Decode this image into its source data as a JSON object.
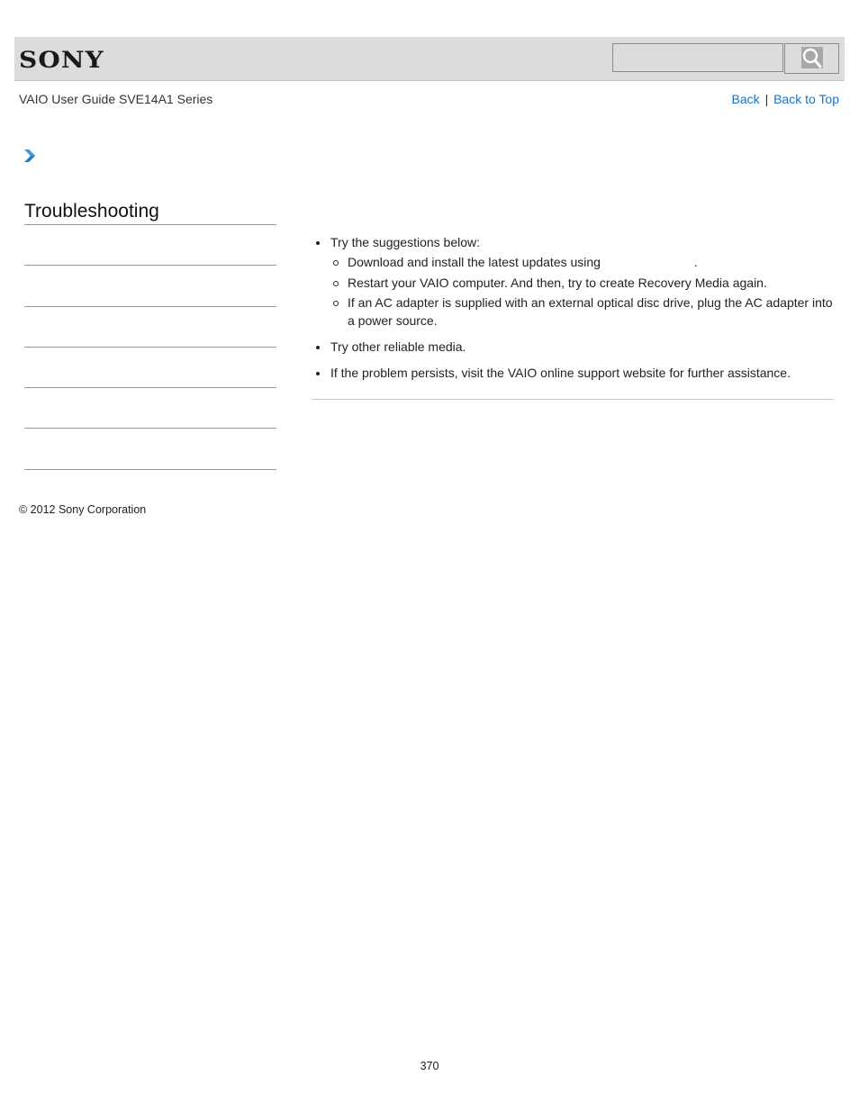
{
  "header": {
    "logo_text": "SONY",
    "search": {
      "placeholder": "",
      "value": "",
      "button_icon": "search-icon"
    }
  },
  "subheader": {
    "guide_title": "VAIO User Guide SVE14A1 Series",
    "links": {
      "back": "Back",
      "separator": "|",
      "back_to_top": "Back to Top"
    }
  },
  "breadcrumb": {
    "icon": "chevron-right-icon",
    "accent_color": "#1e7fc4"
  },
  "sidebar": {
    "heading": "Troubleshooting",
    "items": [
      {
        "label": ""
      },
      {
        "label": ""
      },
      {
        "label": ""
      },
      {
        "label": ""
      },
      {
        "label": ""
      },
      {
        "label": ""
      }
    ]
  },
  "content": {
    "items": [
      {
        "text": "Try the suggestions below:",
        "subitems": [
          {
            "text_before": "Download and install the latest updates using",
            "link_text": "",
            "text_after": "."
          },
          {
            "text": "Restart your VAIO computer. And then, try to create Recovery Media again."
          },
          {
            "text": "If an AC adapter is supplied with an external optical disc drive, plug the AC adapter into a power source."
          }
        ]
      },
      {
        "text": "Try other reliable media."
      },
      {
        "text": "If the problem persists, visit the VAIO online support website for further assistance."
      }
    ]
  },
  "footer": {
    "copyright": "© 2012 Sony Corporation",
    "page_number": "370"
  }
}
